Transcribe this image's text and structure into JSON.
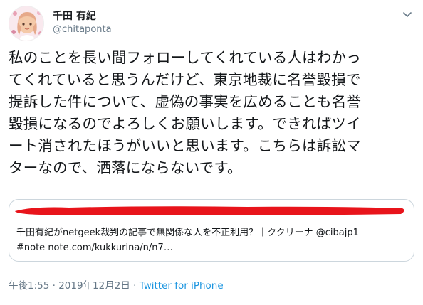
{
  "user": {
    "display_name": "千田 有紀",
    "handle": "@chitaponta"
  },
  "tweet": {
    "text": "私のことを長い間フォローしてくれている人はわかっ\nてくれていると思うんだけど、東京地裁に名誉毀損で\n提訴した件について、虚偽の事実を広めることも名誉\n毀損になるのでよろしくお願いします。できればツイ\nート消されたほうがいいと思います。こちらは訴訟マ\nターなので、洒落にならないです。"
  },
  "card": {
    "line1": "千田有紀がnetgeek裁判の記事で無関係な人を不正利用？｜ククリーナ @cibajp1",
    "line2": "#note note.com/kukkurina/n/n7…",
    "redaction_color": "#e8141b"
  },
  "meta": {
    "time": "午後1:55",
    "separator": " · ",
    "date": "2019年12月2日",
    "source": "Twitter for iPhone"
  },
  "icons": {
    "menu": "chevron-down-icon",
    "avatar": "avatar-illustration"
  },
  "colors": {
    "link": "#1b95e0",
    "secondary_text": "#657786",
    "border": "#ccd6dd"
  }
}
